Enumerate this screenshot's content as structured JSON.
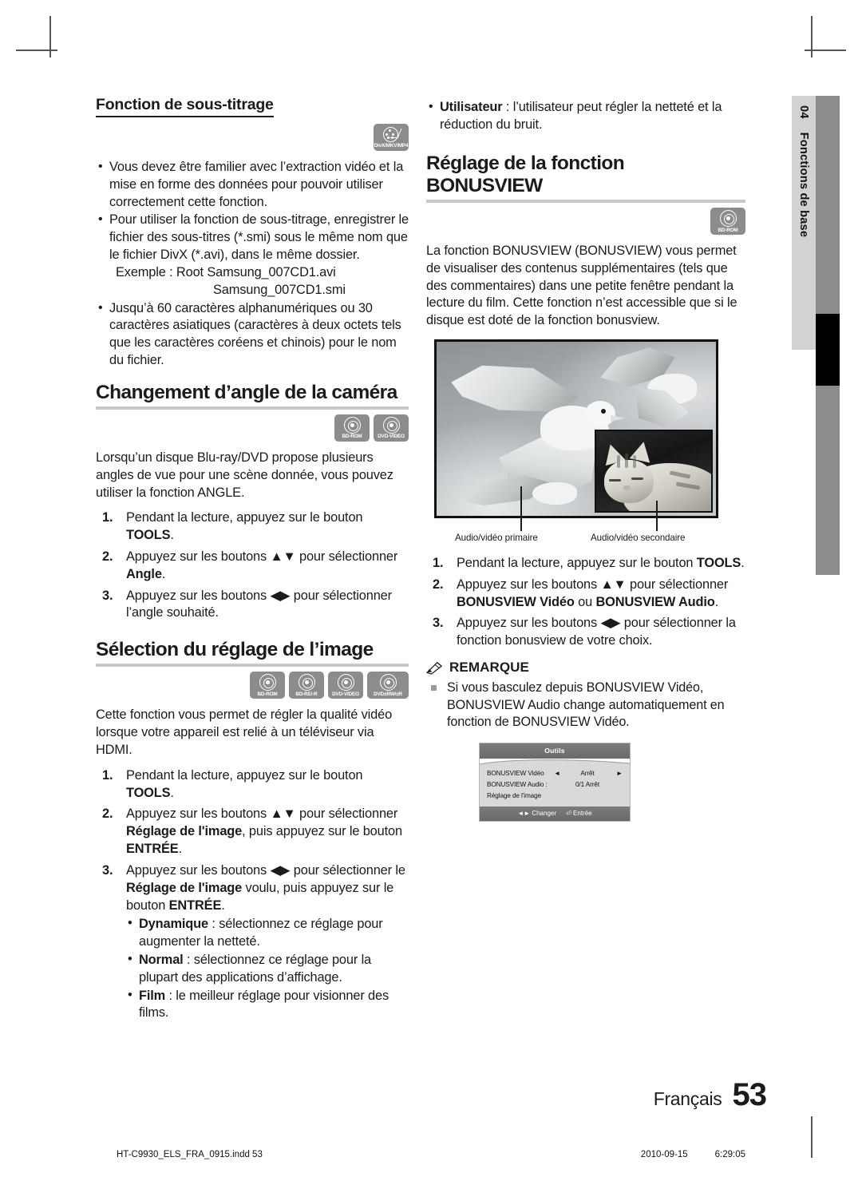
{
  "side_tab": {
    "chapter_number": "04",
    "chapter_title": "Fonctions de base"
  },
  "left_column": {
    "heading_subtitle": "Fonction de sous-titrage",
    "badge_divx": "DivX/MKV/MP4",
    "subtitle_bullets": [
      "Vous devez être familier avec l’extraction vidéo et la mise en forme des données pour pouvoir utiliser correctement cette fonction.",
      "Pour utiliser la fonction de sous-titrage, enregistrer le fichier des sous-titres (*.smi) sous le même nom que le fichier DivX (*.avi), dans le même dossier."
    ],
    "example_line1": "Exemple : Root Samsung_007CD1.avi",
    "example_line2": "Samsung_007CD1.smi",
    "subtitle_bullet3": "Jusqu’à 60 caractères alphanumériques ou 30 caractères asiatiques (caractères à deux octets tels que les caractères coréens et chinois) pour le nom du fichier.",
    "heading_angle": "Changement d’angle de la caméra",
    "angle_badges": [
      "BD-ROM",
      "DVD-VIDEO"
    ],
    "angle_intro": "Lorsqu’un disque Blu-ray/DVD propose plusieurs angles de vue pour une scène donnée, vous pouvez utiliser la fonction ANGLE.",
    "angle_steps": [
      {
        "num": "1.",
        "pre": "Pendant la lecture, appuyez sur le bouton ",
        "bold": "TOOLS",
        "post": "."
      },
      {
        "num": "2.",
        "pre": "Appuyez sur les boutons ▲▼ pour sélectionner ",
        "bold": "Angle",
        "post": "."
      },
      {
        "num": "3.",
        "pre": "Appuyez sur les boutons ◀▶ pour sélectionner l’angle souhaité.",
        "bold": "",
        "post": ""
      }
    ],
    "heading_picture": "Sélection du réglage de l’image",
    "picture_badges": [
      "BD-ROM",
      "BD-RE/-R",
      "DVD-VIDEO",
      "DVD±RW/±R"
    ],
    "picture_intro": "Cette fonction vous permet de régler la qualité vidéo lorsque votre appareil est relié à un téléviseur via HDMI.",
    "picture_step1_pre": "Pendant la lecture, appuyez sur le bouton ",
    "picture_step1_bold": "TOOLS",
    "picture_step1_post": ".",
    "picture_step2_a": "Appuyez sur les boutons ▲▼ pour sélectionner ",
    "picture_step2_b": "Réglage de l'image",
    "picture_step2_c": ", puis appuyez sur le bouton ",
    "picture_step2_d": "ENTRÉE",
    "picture_step2_e": ".",
    "picture_step3_a": "Appuyez sur les boutons ◀▶ pour sélectionner le ",
    "picture_step3_b": "Réglage de l'image",
    "picture_step3_c": " voulu, puis appuyez sur le bouton ",
    "picture_step3_d": "ENTRÉE",
    "picture_step3_e": ".",
    "picture_modes": [
      {
        "name": "Dynamique",
        "desc": " : sélectionnez ce réglage pour augmenter la netteté."
      },
      {
        "name": "Normal",
        "desc": " : sélectionnez ce réglage pour la plupart des applications d’affichage."
      },
      {
        "name": "Film",
        "desc": " : le meilleur réglage pour visionner des films."
      }
    ]
  },
  "right_column": {
    "user_mode_name": "Utilisateur",
    "user_mode_desc": " : l’utilisateur peut régler la netteté et la réduction du bruit.",
    "heading_bonusview": "Réglage de la fonction BONUSVIEW",
    "bonusview_badge": "BD-ROM",
    "bonusview_intro": "La fonction BONUSVIEW (BONUSVIEW) vous permet de visualiser des contenus supplémentaires (tels que des commentaires) dans une petite fenêtre pendant la lecture du film. Cette fonction n’est accessible que si le disque est doté de la fonction bonusview.",
    "caption_primary": "Audio/vidéo primaire",
    "caption_secondary": "Audio/vidéo secondaire",
    "bonusview_step1_pre": "Pendant la lecture, appuyez sur le bouton ",
    "bonusview_step1_bold": "TOOLS",
    "bonusview_step1_post": ".",
    "bonusview_step2_a": "Appuyez sur les boutons ▲▼ pour sélectionner ",
    "bonusview_step2_b": "BONUSVIEW Vidéo",
    "bonusview_step2_c": " ou ",
    "bonusview_step2_d": "BONUSVIEW Audio",
    "bonusview_step2_e": ".",
    "bonusview_step3": "Appuyez sur les boutons ◀▶ pour sélectionner la fonction bonusview de votre choix.",
    "note_title": "REMARQUE",
    "notes": [
      "Si vous basculez depuis BONUSVIEW Vidéo, BONUSVIEW Audio change automatiquement en fonction de BONUSVIEW Vidéo."
    ],
    "osd": {
      "title": "Outils",
      "rows": [
        {
          "label": "BONUSVIEW Vidéo",
          "arrow_left": "◄",
          "value": "Arrêt",
          "arrow_right": "►"
        },
        {
          "label": "BONUSVIEW Audio :",
          "arrow_left": "",
          "value": "0/1 Arrêt",
          "arrow_right": ""
        }
      ],
      "plain_row": "Réglage de l'image",
      "footer_change": "◄► Changer",
      "footer_enter": "⏎ Entrée"
    }
  },
  "footer": {
    "language": "Français",
    "page_number": "53",
    "file_name": "HT-C9930_ELS_FRA_0915.indd   53",
    "date": "2010-09-15",
    "time": "6:29:05"
  }
}
